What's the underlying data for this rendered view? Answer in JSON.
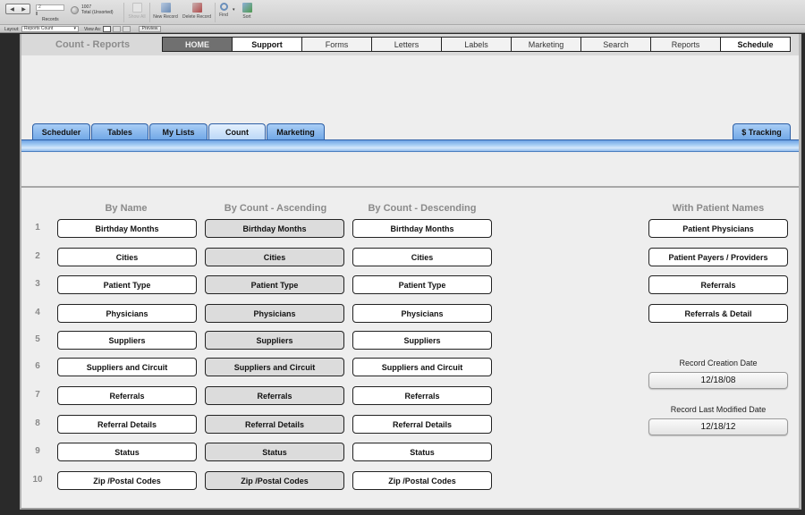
{
  "toolbar": {
    "record_number": "2",
    "records_label": "Records",
    "total_count": "1007",
    "total_label": "Total (Unsorted)",
    "show_all": "Show All",
    "new_record": "New Record",
    "delete_record": "Delete Record",
    "find": "Find",
    "sort": "Sort",
    "layout_label": "Layout:",
    "layout_value": "Reports Count",
    "view_as_label": "View As:",
    "preview": "Preview"
  },
  "header": {
    "title": "Count - Reports",
    "nav": [
      {
        "label": "HOME"
      },
      {
        "label": "Support"
      },
      {
        "label": "Forms"
      },
      {
        "label": "Letters"
      },
      {
        "label": "Labels"
      },
      {
        "label": "Marketing"
      },
      {
        "label": "Search"
      },
      {
        "label": "Reports"
      },
      {
        "label": "Schedule"
      }
    ]
  },
  "tabs": [
    {
      "label": "Scheduler"
    },
    {
      "label": "Tables"
    },
    {
      "label": "My Lists"
    },
    {
      "label": "Count"
    },
    {
      "label": "Marketing"
    }
  ],
  "tab_right": {
    "label": "$ Tracking"
  },
  "columns": {
    "by_name": "By Name",
    "ascending": "By Count - Ascending",
    "descending": "By Count - Descending",
    "patient_names": "With Patient Names"
  },
  "rows": [
    {
      "num": "1",
      "label": "Birthday Months"
    },
    {
      "num": "2",
      "label": "Cities"
    },
    {
      "num": "3",
      "label": "Patient Type"
    },
    {
      "num": "4",
      "label": "Physicians"
    },
    {
      "num": "5",
      "label": "Suppliers"
    },
    {
      "num": "6",
      "label": "Suppliers and Circuit"
    },
    {
      "num": "7",
      "label": "Referrals"
    },
    {
      "num": "8",
      "label": "Referral Details"
    },
    {
      "num": "9",
      "label": "Status"
    },
    {
      "num": "10",
      "label": "Zip /Postal Codes"
    }
  ],
  "patient_reports": [
    {
      "label": "Patient Physicians"
    },
    {
      "label": "Patient  Payers / Providers"
    },
    {
      "label": "Referrals"
    },
    {
      "label": "Referrals & Detail"
    }
  ],
  "dates": {
    "creation_label": "Record Creation Date",
    "creation_value": "12/18/08",
    "modified_label": "Record Last Modified Date",
    "modified_value": "12/18/12"
  }
}
